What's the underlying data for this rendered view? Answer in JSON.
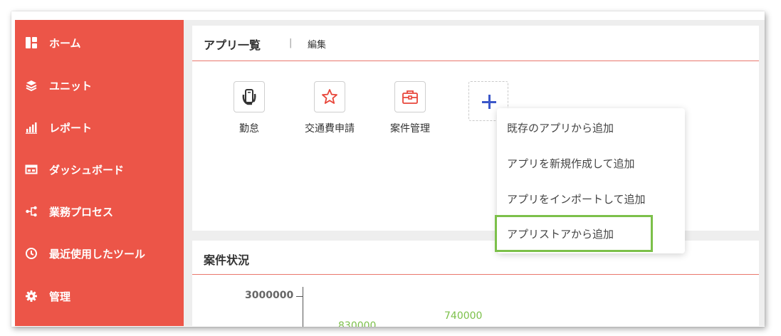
{
  "sidebar": {
    "items": [
      {
        "label": "ホーム",
        "icon": "grid-icon"
      },
      {
        "label": "ユニット",
        "icon": "layers-icon"
      },
      {
        "label": "レポート",
        "icon": "bar-chart-icon"
      },
      {
        "label": "ダッシュボード",
        "icon": "dashboard-icon"
      },
      {
        "label": "業務プロセス",
        "icon": "process-icon"
      },
      {
        "label": "最近使用したツール",
        "icon": "clock-icon"
      },
      {
        "label": "管理",
        "icon": "gear-icon"
      }
    ]
  },
  "apps_panel": {
    "title": "アプリ一覧",
    "separator": "|",
    "edit_label": "編集",
    "apps": [
      {
        "name": "勤怠",
        "icon": "phone-icon"
      },
      {
        "name": "交通費申請",
        "icon": "star-icon"
      },
      {
        "name": "案件管理",
        "icon": "toolbox-icon"
      }
    ],
    "add_icon": "plus-icon"
  },
  "add_menu": {
    "items": [
      "既存のアプリから追加",
      "アプリを新規作成して追加",
      "アプリをインポートして追加",
      "アプリストアから追加"
    ],
    "highlighted_index": 3
  },
  "status_panel": {
    "title": "案件状況",
    "y_tick": "3000000",
    "data_labels": [
      "830000",
      "740000"
    ]
  },
  "colors": {
    "sidebar": "#ec5548",
    "accent_blue": "#3b57c9",
    "highlight_green": "#7cc04a",
    "divider": "#e9776c"
  }
}
